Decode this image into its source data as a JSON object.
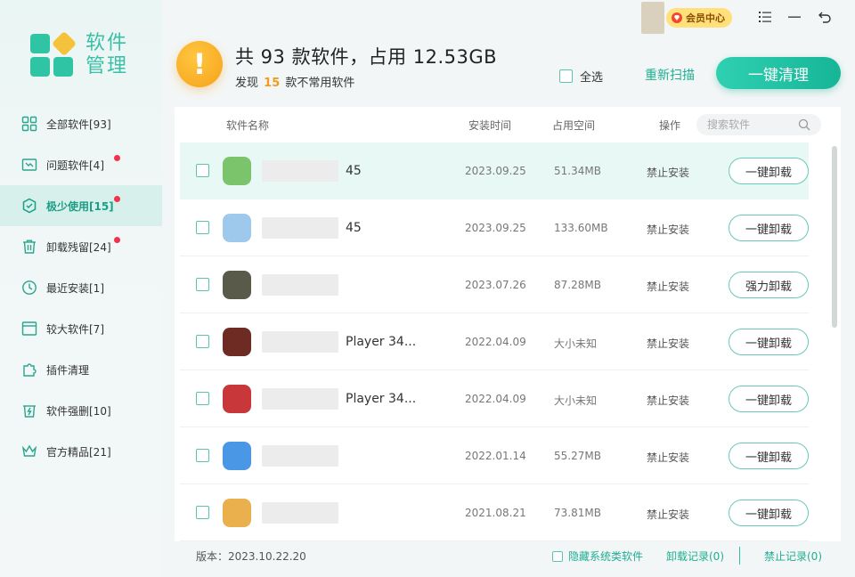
{
  "app": {
    "logo_line1": "软件",
    "logo_line2": "管理"
  },
  "sidebar": {
    "items": [
      {
        "label": "全部软件[93]",
        "icon": "grid-icon",
        "active": false,
        "dot": false
      },
      {
        "label": "问题软件[4]",
        "icon": "broken-box-icon",
        "active": false,
        "dot": true
      },
      {
        "label": "极少使用[15]",
        "icon": "hexagon-icon",
        "active": true,
        "dot": true
      },
      {
        "label": "卸载残留[24]",
        "icon": "trash-icon",
        "active": false,
        "dot": true
      },
      {
        "label": "最近安装[1]",
        "icon": "clock-icon",
        "active": false,
        "dot": false
      },
      {
        "label": "较大软件[7]",
        "icon": "window-icon",
        "active": false,
        "dot": false
      },
      {
        "label": "插件清理",
        "icon": "puzzle-icon",
        "active": false,
        "dot": false
      },
      {
        "label": "软件强删[10]",
        "icon": "force-delete-icon",
        "active": false,
        "dot": false
      },
      {
        "label": "官方精品[21]",
        "icon": "crown-icon",
        "active": false,
        "dot": false
      }
    ]
  },
  "topbar": {
    "vip_label": "会员中心"
  },
  "header": {
    "warn_glyph": "!",
    "headline": "共 93 款软件，占用 12.53GB",
    "sub_prefix": "发现",
    "sub_count": "15",
    "sub_suffix": "款不常用软件",
    "select_all": "全选",
    "rescan": "重新扫描",
    "clean": "一键清理"
  },
  "table": {
    "col_name": "软件名称",
    "col_date": "安装时间",
    "col_size": "占用空间",
    "col_op": "操作",
    "search_placeholder": "搜索软件",
    "rows": [
      {
        "name": "45",
        "date": "2023.09.25",
        "size": "51.34MB",
        "op": "禁止安装",
        "action": "一键卸载",
        "selected": true,
        "icon_color": "#7cc46b"
      },
      {
        "name": "45",
        "date": "2023.09.25",
        "size": "133.60MB",
        "op": "禁止安装",
        "action": "一键卸载",
        "selected": false,
        "icon_color": "#9fc9ec"
      },
      {
        "name": "",
        "date": "2023.07.26",
        "size": "87.28MB",
        "op": "禁止安装",
        "action": "强力卸载",
        "selected": false,
        "icon_color": "#5a5a4a"
      },
      {
        "name": "Player 34...",
        "date": "2022.04.09",
        "size": "大小未知",
        "op": "禁止安装",
        "action": "一键卸载",
        "selected": false,
        "icon_color": "#6e2b24"
      },
      {
        "name": "Player 34...",
        "date": "2022.04.09",
        "size": "大小未知",
        "op": "禁止安装",
        "action": "一键卸载",
        "selected": false,
        "icon_color": "#c8383a"
      },
      {
        "name": "",
        "date": "2022.01.14",
        "size": "55.27MB",
        "op": "禁止安装",
        "action": "一键卸载",
        "selected": false,
        "icon_color": "#4a97e6"
      },
      {
        "name": "",
        "date": "2021.08.21",
        "size": "73.81MB",
        "op": "禁止安装",
        "action": "一键卸载",
        "selected": false,
        "icon_color": "#e9b04d"
      }
    ]
  },
  "footer": {
    "version": "版本：2023.10.22.20",
    "hide_system": "隐藏系统类软件",
    "uninstall_log": "卸载记录(0)",
    "block_log": "禁止记录(0)"
  }
}
